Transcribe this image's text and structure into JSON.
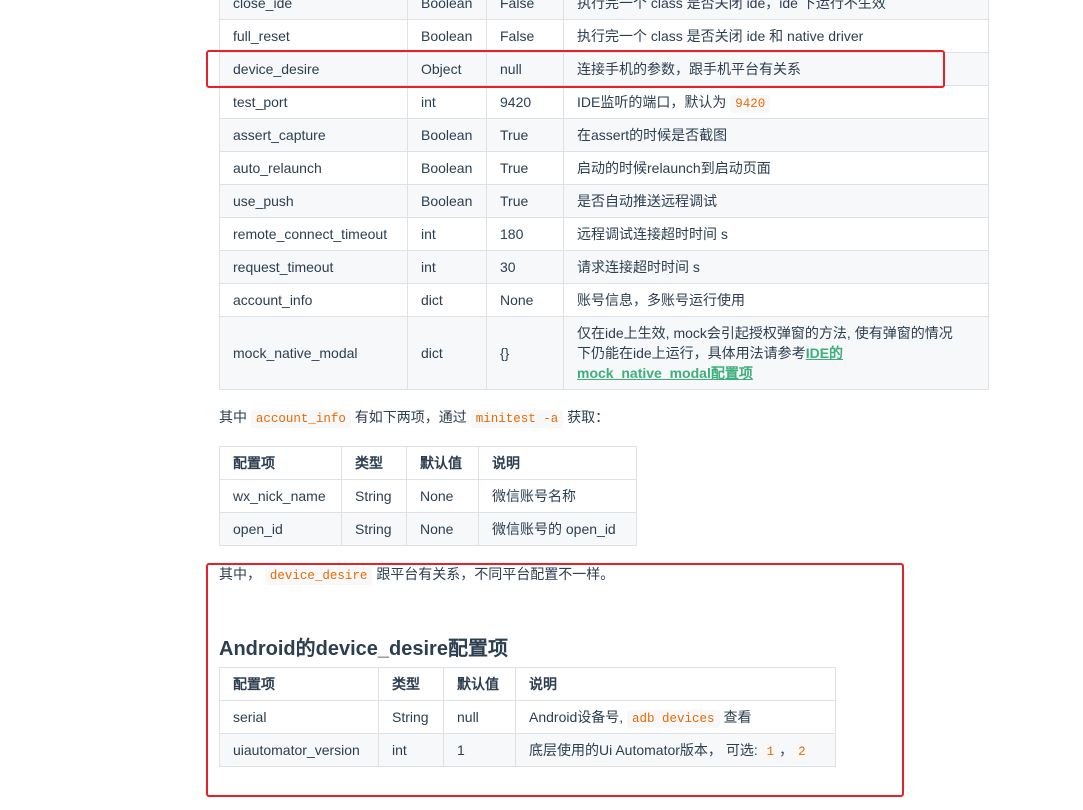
{
  "config_table": {
    "rows": [
      {
        "name": "close_ide",
        "type": "Boolean",
        "default": "False",
        "desc": "执行完一个 class 是否关闭 ide，ide 下运行不生效"
      },
      {
        "name": "full_reset",
        "type": "Boolean",
        "default": "False",
        "desc": "执行完一个 class 是否关闭 ide 和 native driver"
      },
      {
        "name": "device_desire",
        "type": "Object",
        "default": "null",
        "desc": "连接手机的参数，跟手机平台有关系"
      },
      {
        "name": "test_port",
        "type": "int",
        "default": "9420",
        "desc_pre": "IDE监听的端口，默认为",
        "desc_code": "9420"
      },
      {
        "name": "assert_capture",
        "type": "Boolean",
        "default": "True",
        "desc": "在assert的时候是否截图"
      },
      {
        "name": "auto_relaunch",
        "type": "Boolean",
        "default": "True",
        "desc": "启动的时候relaunch到启动页面"
      },
      {
        "name": "use_push",
        "type": "Boolean",
        "default": "True",
        "desc": "是否自动推送远程调试"
      },
      {
        "name": "remote_connect_timeout",
        "type": "int",
        "default": "180",
        "desc": "远程调试连接超时时间 s"
      },
      {
        "name": "request_timeout",
        "type": "int",
        "default": "30",
        "desc": "请求连接超时时间 s"
      },
      {
        "name": "account_info",
        "type": "dict",
        "default": "None",
        "desc": "账号信息，多账号运行使用"
      },
      {
        "name": "mock_native_modal",
        "type": "dict",
        "default": "{}",
        "desc_line1": "仅在ide上生效, mock会引起授权弹窗的方法, 使有弹窗的情况",
        "desc_line2": "下仍能在ide上运行，具体用法请参考",
        "desc_link": "IDE的 mock_native_modal配置项"
      }
    ]
  },
  "account_para": {
    "pre": "其中",
    "code1": "account_info",
    "mid": "有如下两项，通过",
    "code2": "minitest -a",
    "post": "获取："
  },
  "account_table": {
    "headers": [
      "配置项",
      "类型",
      "默认值",
      "说明"
    ],
    "rows": [
      {
        "name": "wx_nick_name",
        "type": "String",
        "default": "None",
        "desc": "微信账号名称"
      },
      {
        "name": "open_id",
        "type": "String",
        "default": "None",
        "desc": "微信账号的 open_id"
      }
    ]
  },
  "device_para": {
    "pre": "其中，",
    "code": "device_desire",
    "post": "跟平台有关系，不同平台配置不一样。"
  },
  "android_heading": "Android的device_desire配置项",
  "android_table": {
    "headers": [
      "配置项",
      "类型",
      "默认值",
      "说明"
    ],
    "rows": [
      {
        "name": "serial",
        "type": "String",
        "default": "null",
        "desc_pre": "Android设备号,",
        "desc_code": "adb devices",
        "desc_post": "查看"
      },
      {
        "name": "uiautomator_version",
        "type": "int",
        "default": "1",
        "desc_pre": "底层使用的Ui Automator版本，  可选:",
        "code_a": "1",
        "sep": "，",
        "code_b": "2"
      }
    ]
  },
  "colors": {
    "annotation_red": "#e6212a",
    "link_green": "#3eaf7c",
    "code_orange": "#e96900"
  }
}
